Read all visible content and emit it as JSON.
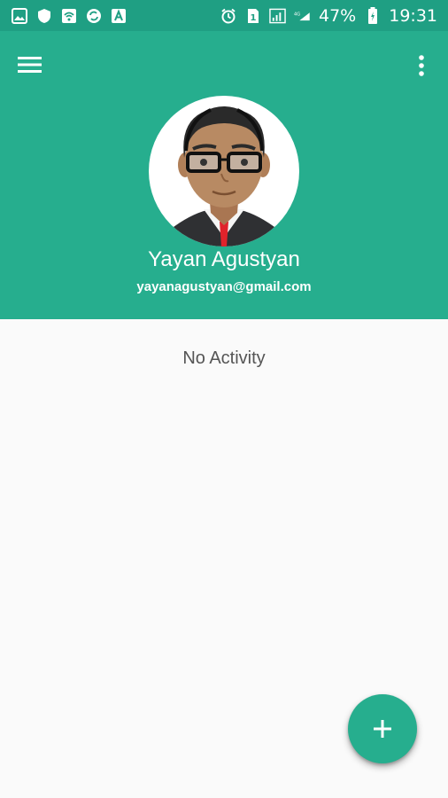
{
  "status_bar": {
    "left_icons": [
      "image-icon",
      "shield-icon",
      "wifi-icon",
      "sync-icon",
      "translate-icon"
    ],
    "right_icons": [
      "alarm-icon",
      "sim-icon",
      "signal-icon",
      "network-4g-icon",
      "battery-icon"
    ],
    "battery_percent": "47%",
    "time": "19:31"
  },
  "header": {
    "menu_icon": "hamburger-menu-icon",
    "more_icon": "more-vert-icon",
    "avatar_icon": "user-avatar",
    "name": "Yayan Agustyan",
    "email": "yayanagustyan@gmail.com"
  },
  "content": {
    "empty_message": "No Activity"
  },
  "fab": {
    "icon": "plus-icon"
  },
  "colors": {
    "primary": "#26ae8e",
    "status_bar": "#1f9f83",
    "background": "#fafafa"
  }
}
